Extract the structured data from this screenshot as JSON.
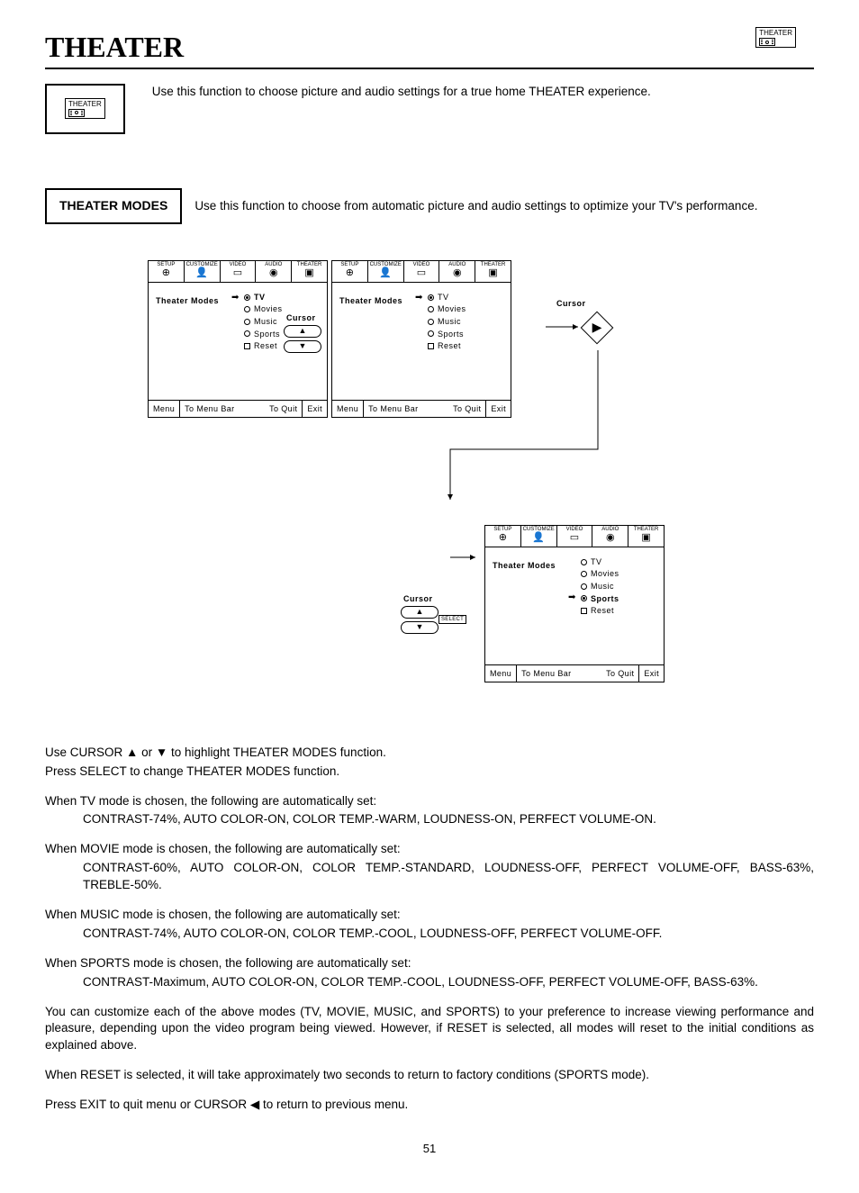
{
  "document": {
    "page_title": "THEATER",
    "page_number": "51",
    "top_icon_label": "THEATER"
  },
  "intro": {
    "icon_label": "THEATER",
    "text": "Use this function to choose picture and audio settings for a true home THEATER experience."
  },
  "modes": {
    "label": "THEATER MODES",
    "text": "Use this function to choose from automatic picture and audio settings to optimize your TV's performance."
  },
  "tabs": {
    "t1": "SETUP",
    "t2": "CUSTOMIZE",
    "t3": "VIDEO",
    "t4": "AUDIO",
    "t5": "THEATER"
  },
  "osd": {
    "title": "Theater Modes",
    "opt1": "TV",
    "opt2": "Movies",
    "opt3": "Music",
    "opt4": "Sports",
    "opt5": "Reset",
    "foot_menu": "Menu",
    "foot_tomenu": "To Menu Bar",
    "foot_toquit": "To Quit",
    "foot_exit": "Exit"
  },
  "labels": {
    "cursor": "Cursor",
    "select": "SELECT"
  },
  "body": {
    "cursor_line": "Use CURSOR ▲ or ▼ to highlight THEATER  MODES function.",
    "press_select": "Press SELECT to change THEATER MODES function.",
    "tv_h": "When TV mode is chosen, the following are automatically set:",
    "tv_d": "CONTRAST-74%, AUTO COLOR-ON, COLOR TEMP.-WARM, LOUDNESS-ON, PERFECT VOLUME-ON.",
    "movie_h": "When MOVIE mode is chosen, the following are automatically set:",
    "movie_d": "CONTRAST-60%, AUTO COLOR-ON, COLOR TEMP.-STANDARD, LOUDNESS-OFF, PERFECT VOLUME-OFF, BASS-63%, TREBLE-50%.",
    "music_h": "When MUSIC mode is chosen, the following are automatically set:",
    "music_d": "CONTRAST-74%, AUTO COLOR-ON, COLOR TEMP.-COOL, LOUDNESS-OFF, PERFECT VOLUME-OFF.",
    "sports_h": "When SPORTS mode is chosen, the following are automatically set:",
    "sports_d": "CONTRAST-Maximum, AUTO COLOR-ON, COLOR TEMP.-COOL, LOUDNESS-OFF, PERFECT VOLUME-OFF, BASS-63%.",
    "customize": "You can customize each of the above modes (TV, MOVIE, MUSIC, and SPORTS) to your preference to increase viewing performance and pleasure, depending upon the video program being viewed. However, if RESET is selected, all modes will reset to the initial conditions as explained above.",
    "reset": "When RESET is selected, it will take approximately two seconds to return to factory conditions (SPORTS mode).",
    "exit": "Press EXIT to quit menu or CURSOR ◀ to return to previous menu."
  }
}
